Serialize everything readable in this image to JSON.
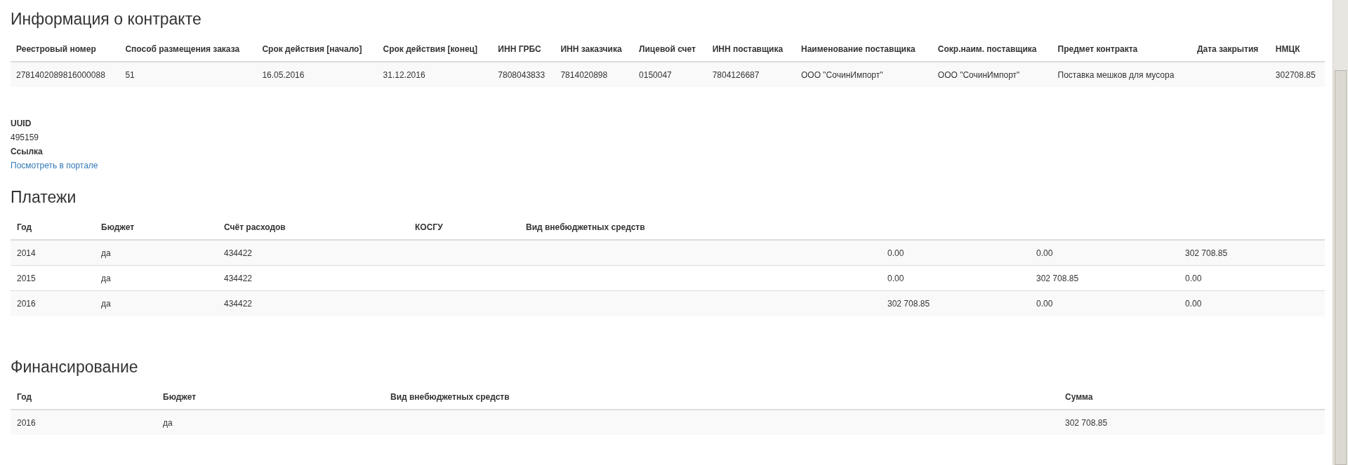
{
  "contract": {
    "title": "Информация о контракте",
    "columns": [
      "Реестровый номер",
      "Способ размещения заказа",
      "Срок действия [начало]",
      "Срок действия [конец]",
      "ИНН ГРБС",
      "ИНН заказчика",
      "Лицевой счет",
      "ИНН поставщика",
      "Наименование поставщика",
      "Сокр.наим. поставщика",
      "Предмет контракта",
      "Дата закрытия",
      "НМЦК"
    ],
    "row": {
      "registry_number": "2781402089816000088",
      "placement_method": "51",
      "start": "16.05.2016",
      "end": "31.12.2016",
      "inn_grbs": "7808043833",
      "inn_customer": "7814020898",
      "account": "0150047",
      "inn_supplier": "7804126687",
      "supplier_name": "ООО \"СочинИмпорт\"",
      "supplier_short": "ООО \"СочинИмпорт\"",
      "subject": "Поставка мешков для мусора",
      "nmck": "302708.85"
    }
  },
  "details": [
    {
      "label": "UUID",
      "value": "495159",
      "kind": "text"
    },
    {
      "label": "Ссылка",
      "value": "Посмотреть в портале",
      "kind": "link"
    }
  ],
  "payments": {
    "title": "Платежи",
    "columns": [
      "Год",
      "Бюджет",
      "Счёт расходов",
      "КОСГУ",
      "Вид внебюджетных средств"
    ],
    "rows": [
      {
        "year": "2014",
        "budget": "да",
        "account": "434422",
        "column_6": "0.00",
        "column_7": "0.00",
        "column_8": "302 708.85"
      },
      {
        "year": "2015",
        "budget": "да",
        "account": "434422",
        "column_6": "0.00",
        "column_7": "302 708.85",
        "column_8": "0.00"
      },
      {
        "year": "2016",
        "budget": "да",
        "account": "434422",
        "column_6": "302 708.85",
        "column_7": "0.00",
        "column_8": "0.00"
      }
    ]
  },
  "financing": {
    "title": "Финансирование",
    "columns": [
      "Год",
      "Бюджет",
      "Вид внебюджетных средств",
      "Сумма"
    ],
    "rows": [
      {
        "year": "2016",
        "budget": "да",
        "sum": "302 708.85"
      }
    ]
  }
}
